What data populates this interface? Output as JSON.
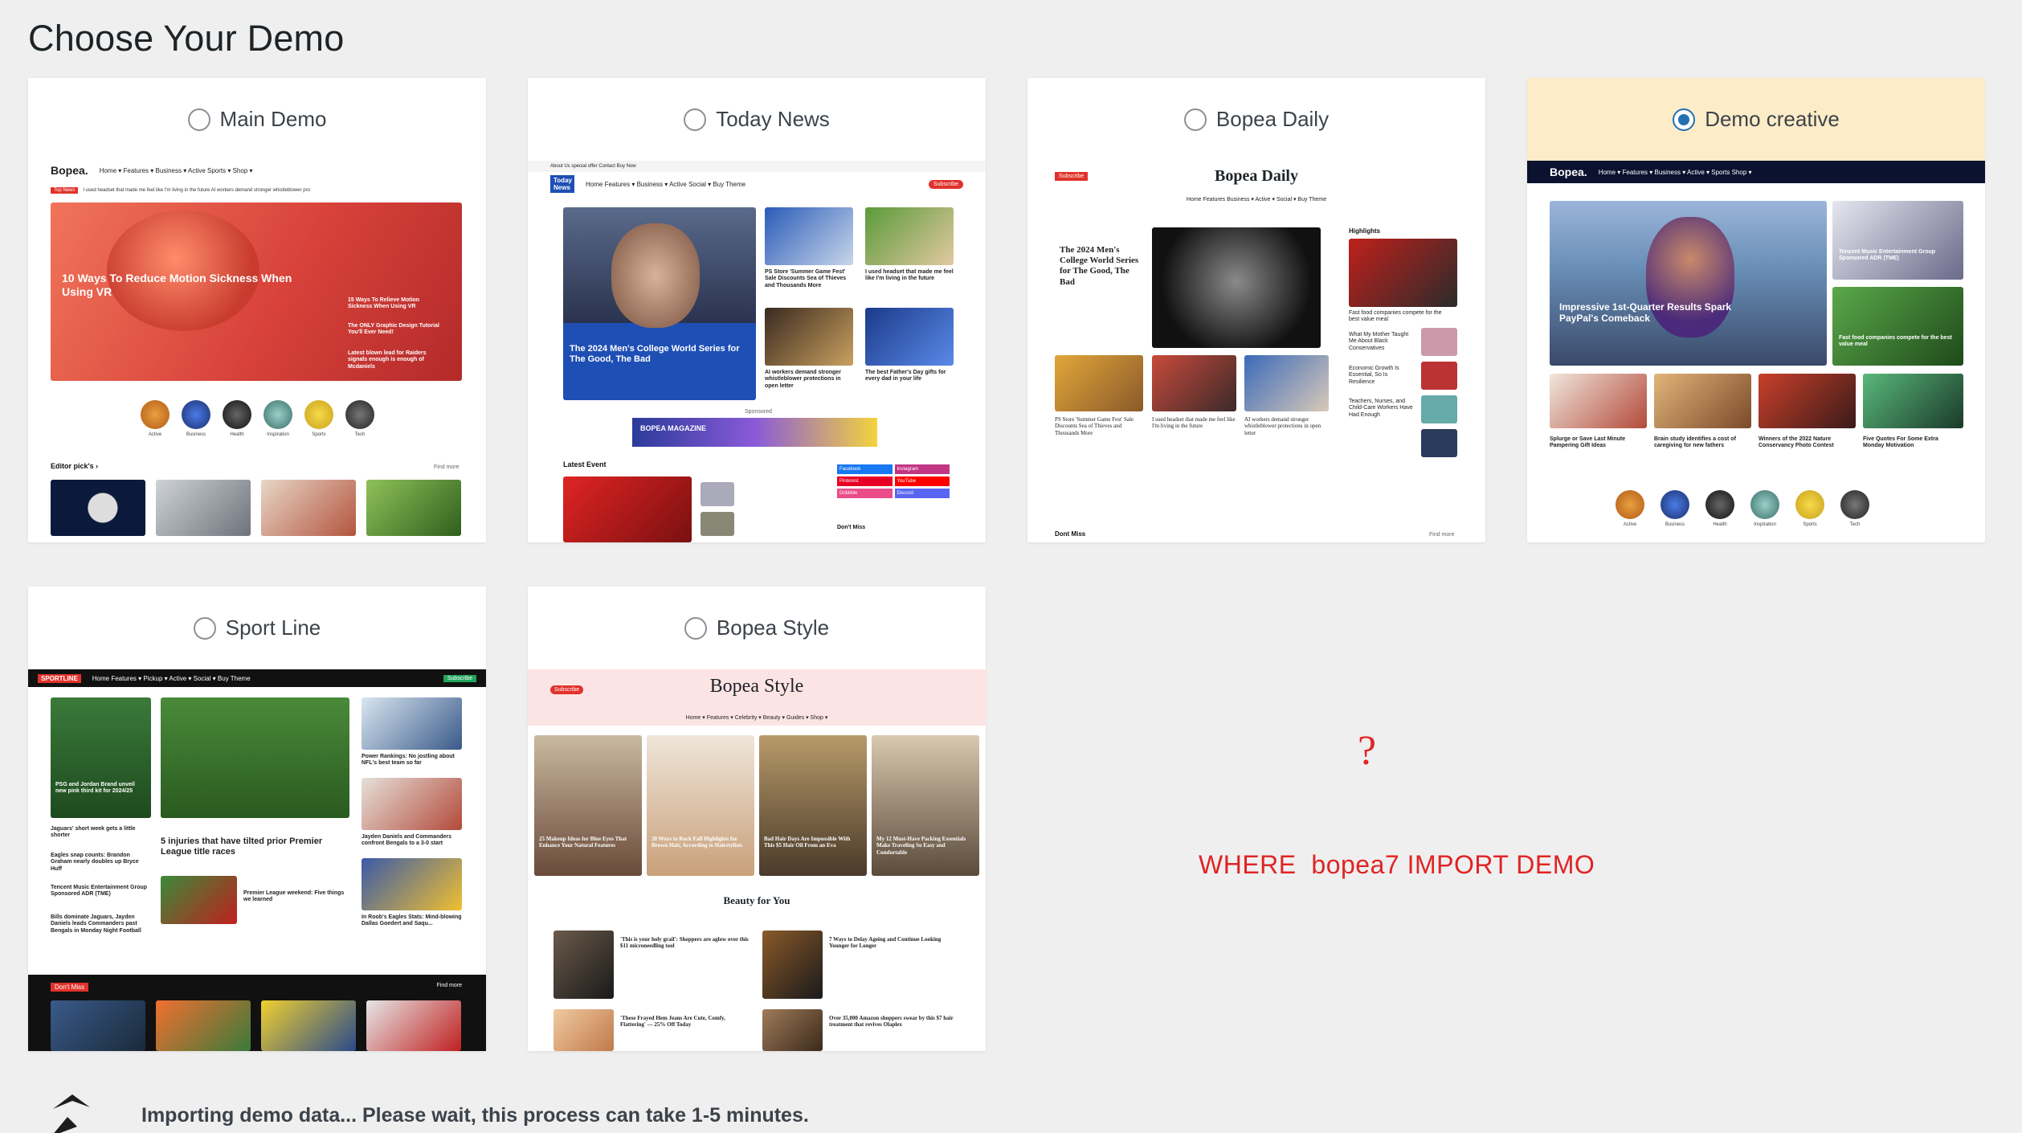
{
  "page": {
    "title": "Choose Your Demo"
  },
  "demos": [
    {
      "label": "Main Demo",
      "selected": false
    },
    {
      "label": "Today News",
      "selected": false
    },
    {
      "label": "Bopea Daily",
      "selected": false
    },
    {
      "label": "Demo creative",
      "selected": true
    },
    {
      "label": "Sport Line",
      "selected": false
    },
    {
      "label": "Bopea Style",
      "selected": false
    }
  ],
  "previews": {
    "main": {
      "logo": "Bopea.",
      "nav": "Home ▾   Features ▾   Business ▾   Active   Sports ▾   Shop ▾",
      "ticker_tag": "Top News",
      "ticker": "I used headset that made me feel like I'm living in the future     AI workers demand stronger whistleblower pro",
      "hero_title": "10 Ways To Reduce Motion Sickness When Using VR",
      "side1": "15 Ways To Relieve Motion Sickness When Using VR",
      "side2": "The ONLY Graphic Design Tutorial You'll Ever Need!",
      "side3": "Latest blown lead for Raiders signals enough is enough of Mcdaniels",
      "cats": [
        "Active",
        "Business",
        "Health",
        "Inspiration",
        "Sports",
        "Tech"
      ],
      "section": "Editor pick's  ›",
      "findmore": "Find more"
    },
    "today": {
      "topbar": "About Us   special offer   Contact   Buy Now",
      "logo": "Today News",
      "nav": "Home   Features ▾   Business ▾   Active   Social ▾   Buy Theme",
      "subscribe": "Subscribe",
      "hero_title": "The 2024 Men's College World Series for The Good, The Bad",
      "c1": "PS Store 'Summer Game Fest' Sale Discounts Sea of Thieves and Thousands More",
      "c2": "I used headset that made me feel like I'm living in the future",
      "c3": "AI workers demand stronger whistleblower protections in open letter",
      "c4": "The best Father's Day gifts for every dad in your life",
      "sponsored": "Sponsored",
      "banner": "BOPEA MAGAZINE",
      "latest": "Latest Event",
      "socials": [
        "Facebook",
        "Instagram",
        "Pinterest",
        "YouTube",
        "Dribbble",
        "Discord"
      ],
      "dontmiss": "Don't Miss"
    },
    "daily": {
      "logo": "Bopea Daily",
      "subscribe": "Subscribe",
      "nav": "Home   Features   Business ▾   Active ▾   Social ▾   Buy Theme",
      "hero_title": "The 2024 Men's College World Series for The Good, The Bad",
      "highlights": "Highlights",
      "h1": "Fast food companies compete for the best value meal",
      "h2": "What My Mother Taught Me About Black Conservatives",
      "h3": "Economic Growth Is Essential, So Is Resilience",
      "h4": "Teachers, Nurses, and Child-Care Workers Have Had Enough",
      "g1": "PS Store 'Summer Game Fest' Sale Discounts Sea of Thieves and Thousands More",
      "g2": "I used headset that made me feel like I'm living in the future",
      "g3": "AI workers demand stronger whistleblower protections in open letter",
      "dontmiss": "Dont Miss",
      "findmore": "Find more"
    },
    "creative": {
      "logo": "Bopea.",
      "nav": "Home ▾   Features ▾   Business ▾   Active ▾   Sports   Shop ▾",
      "hero_title": "Impressive 1st-Quarter Results Spark PayPal's Comeback",
      "s1": "Tencent Music Entertainment Group Sponsored ADR (TME)",
      "s2": "Fast food companies compete for the best value meal",
      "r1": "Splurge or Save Last Minute Pampering Gift Ideas",
      "r2": "Brain study identifies a cost of caregiving for new fathers",
      "r3": "Winners of the 2022 Nature Conservancy Photo Contest",
      "r4": "Five Quotes For Some Extra Monday Motivation",
      "cats": [
        "Active",
        "Business",
        "Health",
        "Inspiration",
        "Sports",
        "Tech"
      ]
    },
    "sport": {
      "logo": "SPORTLINE",
      "nav": "Home   Features ▾   Pickup ▾   Active ▾   Social ▾   Buy Theme",
      "subscribe": "Subscribe",
      "a1": "PSG and Jordan Brand unveil new pink third kit for 2024/25",
      "main": "5 injuries that have tilted prior Premier League title races",
      "r1": "Power Rankings: No jostling about NFL's best team so far",
      "r2": "Jayden Daniels and Commanders confront Bengals to a 3-0 start",
      "r3": "In Roob's Eagles Stats: Mind-blowing Dallas Goedert and Saqu...",
      "l1": "Jaguars' short week gets a little shorter",
      "l2": "Eagles snap counts: Brandon Graham nearly doubles up Bryce Huff",
      "l3": "Tencent Music Entertainment Group Sponsored ADR (TME)",
      "l4": "Bills dominate Jaguars, Jayden Daniels leads Commanders past Bengals in Monday Night Football",
      "m2": "Premier League weekend: Five things we learned",
      "dontmiss": "Don't Miss",
      "findmore": "Find more"
    },
    "style": {
      "logo": "Bopea Style",
      "subscribe": "Subscribe",
      "nav": "Home ▾   Features ▾   Celebrity ▾   Beauty ▾   Guides ▾   Shop ▾",
      "t1": "25 Makeup Ideas for Blue Eyes That Enhance Your Natural Features",
      "t2": "20 Ways to Rock Fall Highlights for Brown Hair, According to Hairstylists",
      "t3": "Bad Hair Days Are Impossible With This $5 Hair Oil From an Eva",
      "t4": "My 12 Must-Have Packing Essentials Make Traveling So Easy and Comfortable",
      "section": "Beauty for You",
      "b1": "'This is your holy grail': Shoppers are aglow over this $11 microneedling tool",
      "b2": "7 Ways to Delay Ageing and Continue Looking Younger for Longer",
      "b3": "'These Frayed Hem Jeans Are Cute, Comfy, Flattering' — 25% Off Today",
      "b4": "Over 35,000 Amazon shoppers swear by this $7 hair treatment that revives Olaplex"
    }
  },
  "annotation": {
    "question": "?",
    "message": "WHERE  bopea7 IMPORT DEMO"
  },
  "status": {
    "importing": "Importing demo data... Please wait, this process can take 1-5 minutes."
  },
  "colors": {
    "accent": "#2271b1",
    "selected_bg": "#fdecc8",
    "annotation": "#e02424"
  }
}
